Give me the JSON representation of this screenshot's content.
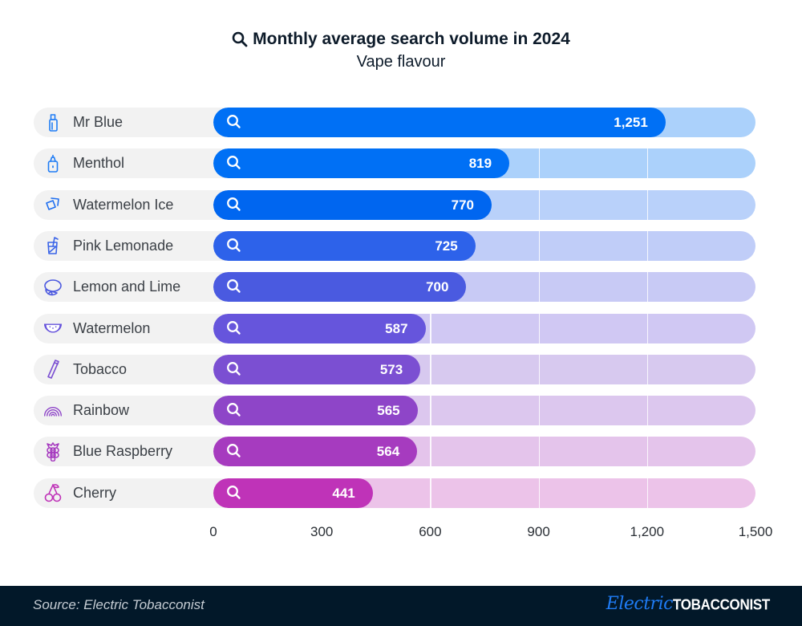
{
  "header": {
    "title": "Monthly average search volume in 2024",
    "title_icon": "search-icon",
    "subtitle": "Vape flavour"
  },
  "chart_data": {
    "type": "bar",
    "orientation": "horizontal",
    "title": "Monthly average search volume in 2024",
    "subtitle": "Vape flavour",
    "xlabel": "",
    "ylabel": "",
    "xlim": [
      0,
      1500
    ],
    "grid": true,
    "categories": [
      "Mr Blue",
      "Menthol",
      "Watermelon Ice",
      "Pink Lemonade",
      "Lemon and Lime",
      "Watermelon",
      "Tobacco",
      "Rainbow",
      "Blue Raspberry",
      "Cherry"
    ],
    "values": [
      1251,
      819,
      770,
      725,
      700,
      587,
      573,
      565,
      564,
      441
    ],
    "value_labels": [
      "1,251",
      "819",
      "770",
      "725",
      "700",
      "587",
      "573",
      "565",
      "564",
      "441"
    ],
    "icons": [
      "vape-bottle-icon",
      "menthol-bottle-icon",
      "ice-cubes-icon",
      "lemonade-glass-icon",
      "lemon-lime-icon",
      "watermelon-slice-icon",
      "cigarette-icon",
      "rainbow-icon",
      "raspberry-icon",
      "cherry-icon"
    ],
    "bar_colors": [
      "#0070f5",
      "#0070f5",
      "#0066f0",
      "#2d62ea",
      "#4a5ae0",
      "#6655dc",
      "#7b4fd2",
      "#8e45c8",
      "#a63bbf",
      "#bf33b8"
    ],
    "track_colors": [
      "#abd1fb",
      "#abd1fb",
      "#b9d1fa",
      "#c0cdf8",
      "#c8caf5",
      "#d0c8f3",
      "#d7c9ef",
      "#dcc7ee",
      "#e4c4eb",
      "#ecc3e9"
    ],
    "icon_colors": [
      "#1f7cf5",
      "#1f7cf5",
      "#1f6ff0",
      "#3a64e8",
      "#4d5ae0",
      "#6552dc",
      "#7b4fd2",
      "#8e45c8",
      "#a63bbf",
      "#bf33b8"
    ],
    "x_ticks": [
      0,
      300,
      600,
      900,
      1200,
      1500
    ],
    "x_tick_labels": [
      "0",
      "300",
      "600",
      "900",
      "1,200",
      "1,500"
    ],
    "gridlines": [
      300,
      600,
      900,
      1200
    ]
  },
  "footer": {
    "source": "Source: Electric Tobacconist",
    "brand_script": "Electric",
    "brand_caps": "TOBACCONIST"
  }
}
